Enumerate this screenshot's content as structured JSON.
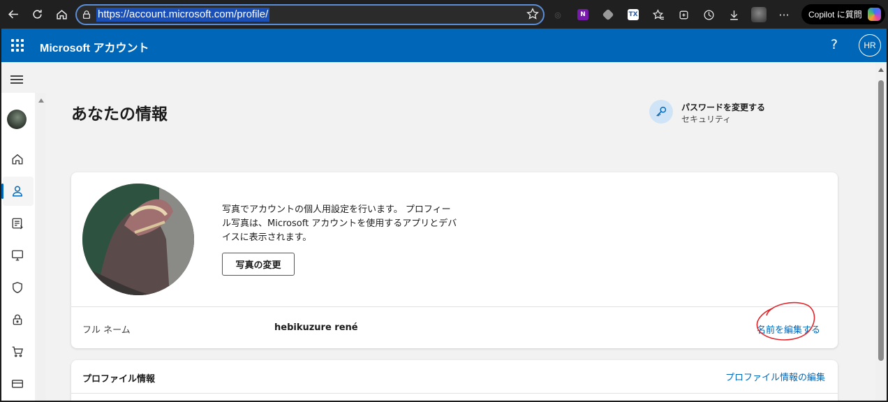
{
  "browser": {
    "url": "https://account.microsoft.com/profile/",
    "copilot_label": "Copilot に質問"
  },
  "header": {
    "app_title": "Microsoft アカウント",
    "help_label": "?",
    "user_initials": "HR",
    "accent_color": "#0067b8"
  },
  "page": {
    "title": "あなたの情報",
    "password_link": {
      "title": "パスワードを変更する",
      "subtitle": "セキュリティ",
      "icon": "key-icon"
    }
  },
  "sidebar": {
    "items": [
      {
        "icon": "home-icon"
      },
      {
        "icon": "person-icon",
        "active": true
      },
      {
        "icon": "subscriptions-icon"
      },
      {
        "icon": "devices-icon"
      },
      {
        "icon": "shield-icon"
      },
      {
        "icon": "lock-icon"
      },
      {
        "icon": "cart-icon"
      },
      {
        "icon": "payment-card-icon"
      }
    ]
  },
  "photo_card": {
    "description": "写真でアカウントの個人用設定を行います。 プロフィール写真は、Microsoft アカウントを使用するアプリとデバイスに表示されます。",
    "change_photo_label": "写真の変更",
    "fullname_label": "フル ネーム",
    "fullname_value": "hebikuzure rené",
    "edit_name_label": "名前を編集する"
  },
  "profile_card": {
    "title": "プロファイル情報",
    "edit_label": "プロファイル情報の編集"
  }
}
